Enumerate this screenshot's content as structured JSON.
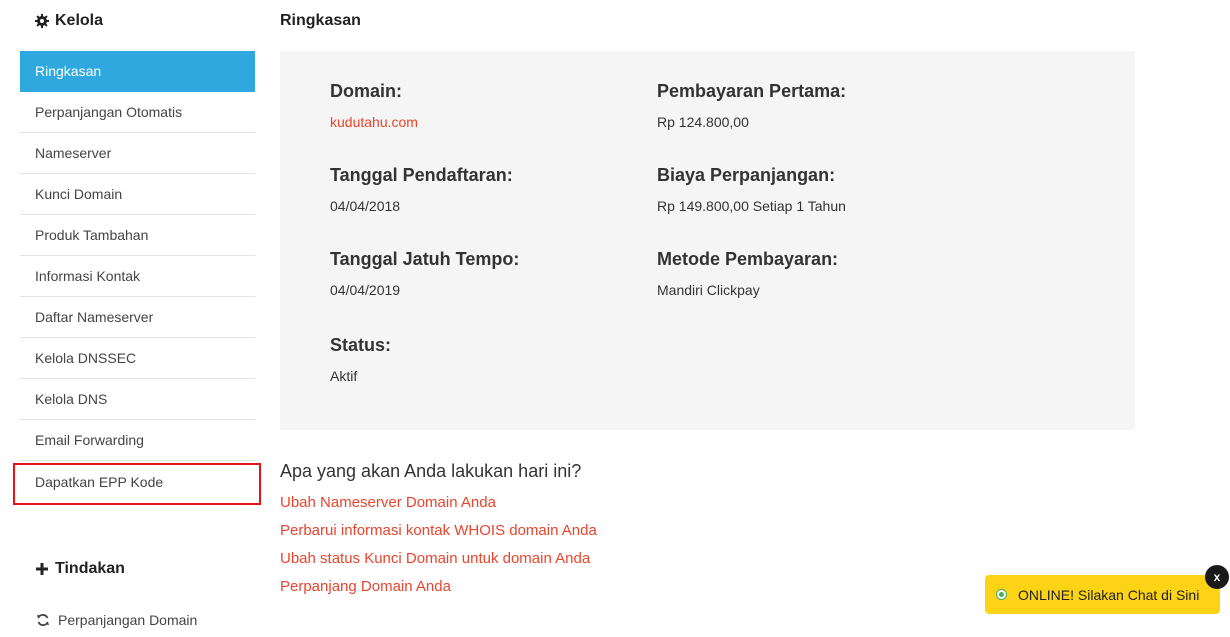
{
  "sidebar": {
    "manage_heading": "Kelola",
    "items": [
      {
        "label": "Ringkasan"
      },
      {
        "label": "Perpanjangan Otomatis"
      },
      {
        "label": "Nameserver"
      },
      {
        "label": "Kunci Domain"
      },
      {
        "label": "Produk Tambahan"
      },
      {
        "label": "Informasi Kontak"
      },
      {
        "label": "Daftar Nameserver"
      },
      {
        "label": "Kelola DNSSEC"
      },
      {
        "label": "Kelola DNS"
      },
      {
        "label": "Email Forwarding"
      },
      {
        "label": "Dapatkan EPP Kode"
      }
    ],
    "active_index": 0,
    "highlight_color": "#e8101a",
    "active_color": "#2fa8e0",
    "actions_heading": "Tindakan",
    "actions": [
      {
        "label": "Perpanjangan Domain",
        "icon": "refresh-icon"
      }
    ]
  },
  "main": {
    "title": "Ringkasan",
    "summary": {
      "domain_label": "Domain:",
      "domain_value": "kudutahu.com",
      "registration_label": "Tanggal Pendaftaran:",
      "registration_value": "04/04/2018",
      "due_label": "Tanggal Jatuh Tempo:",
      "due_value": "04/04/2019",
      "status_label": "Status:",
      "status_value": "Aktif",
      "first_payment_label": "Pembayaran Pertama:",
      "first_payment_value": "Rp 124.800,00",
      "renewal_label": "Biaya Perpanjangan:",
      "renewal_value": "Rp 149.800,00 Setiap 1 Tahun",
      "method_label": "Metode Pembayaran:",
      "method_value": "Mandiri Clickpay"
    },
    "todo_heading": "Apa yang akan Anda lakukan hari ini?",
    "todo_links": [
      "Ubah Nameserver Domain Anda",
      "Perbarui informasi kontak WHOIS domain Anda",
      "Ubah status Kunci Domain untuk domain Anda",
      "Perpanjang Domain Anda"
    ],
    "link_color": "#e8452c"
  },
  "chat": {
    "label": "ONLINE! Silakan Chat di Sini",
    "close_label": "x",
    "color": "#fdd415"
  }
}
